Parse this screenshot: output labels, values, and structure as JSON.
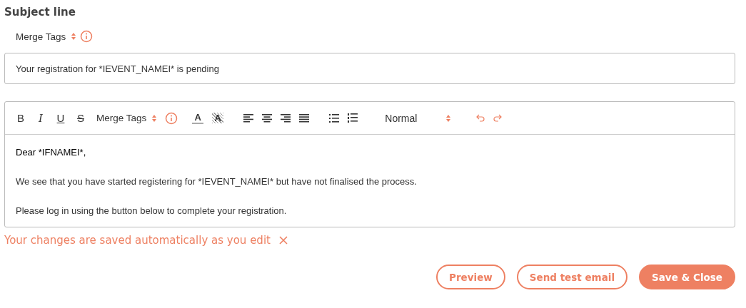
{
  "subject": {
    "heading": "Subject line",
    "merge_tags_label": "Merge Tags",
    "value": "Your registration for *IEVENT_NAMEI* is pending"
  },
  "editor": {
    "format_buttons": [
      {
        "label": "B",
        "kind": "bold"
      },
      {
        "label": "I",
        "kind": "italic"
      },
      {
        "label": "U",
        "kind": "underline"
      },
      {
        "label": "S",
        "kind": "strike"
      }
    ],
    "merge_tags_label": "Merge Tags",
    "text_color_label": "A",
    "highlight_label": "A",
    "style_select": "Normal",
    "paragraphs": [
      "Dear *IFNAMEI*,",
      "We see that you have started registering for *IEVENT_NAMEI* but have not finalised the process.",
      "Please log in using the button below to complete your registration."
    ]
  },
  "notice": "Your changes are saved automatically as you edit",
  "buttons": [
    {
      "label": "Preview",
      "kind": "outline"
    },
    {
      "label": "Send test email",
      "kind": "outline"
    },
    {
      "label": "Save & Close",
      "kind": "primary"
    }
  ]
}
